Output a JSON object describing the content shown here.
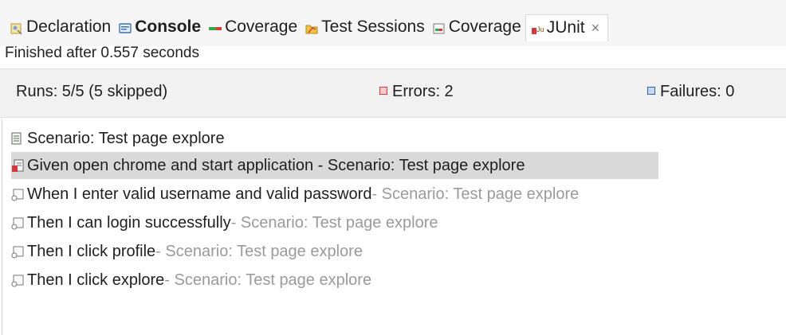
{
  "tabs": [
    {
      "label": "Declaration",
      "icon": "declaration-icon",
      "active": false,
      "bold": false
    },
    {
      "label": "Console",
      "icon": "console-icon",
      "active": false,
      "bold": true
    },
    {
      "label": "Coverage",
      "icon": "coverage-bar-icon",
      "active": false,
      "bold": false
    },
    {
      "label": "Test Sessions",
      "icon": "test-sessions-icon",
      "active": false,
      "bold": false
    },
    {
      "label": "Coverage",
      "icon": "coverage-report-icon",
      "active": false,
      "bold": false
    },
    {
      "label": "JUnit",
      "icon": "junit-icon",
      "active": true,
      "bold": false
    }
  ],
  "close_glyph": "×",
  "status": "Finished after 0.557 seconds",
  "summary": {
    "runs": "Runs:  5/5 (5 skipped)",
    "errors": "Errors:  2",
    "failures": "Failures:  0"
  },
  "tree": [
    {
      "text": "Scenario: Test page explore",
      "suffix": "",
      "state": "error-suite",
      "selected": false
    },
    {
      "text": "Given open chrome and start application - Scenario: Test page explore",
      "suffix": "",
      "state": "error-test",
      "selected": true
    },
    {
      "text": "When I enter valid username and valid password",
      "suffix": " - Scenario: Test page explore",
      "state": "skipped",
      "selected": false
    },
    {
      "text": "Then I can login successfully",
      "suffix": " - Scenario: Test page explore",
      "state": "skipped",
      "selected": false
    },
    {
      "text": "Then I click profile",
      "suffix": " - Scenario: Test page explore",
      "state": "skipped",
      "selected": false
    },
    {
      "text": "Then I click explore",
      "suffix": " - Scenario: Test page explore",
      "state": "skipped",
      "selected": false
    }
  ],
  "colors": {
    "error": "#d6383f",
    "failure": "#2e5fa8",
    "selection": "#d9d9d9",
    "muted": "#9a9a9a"
  }
}
